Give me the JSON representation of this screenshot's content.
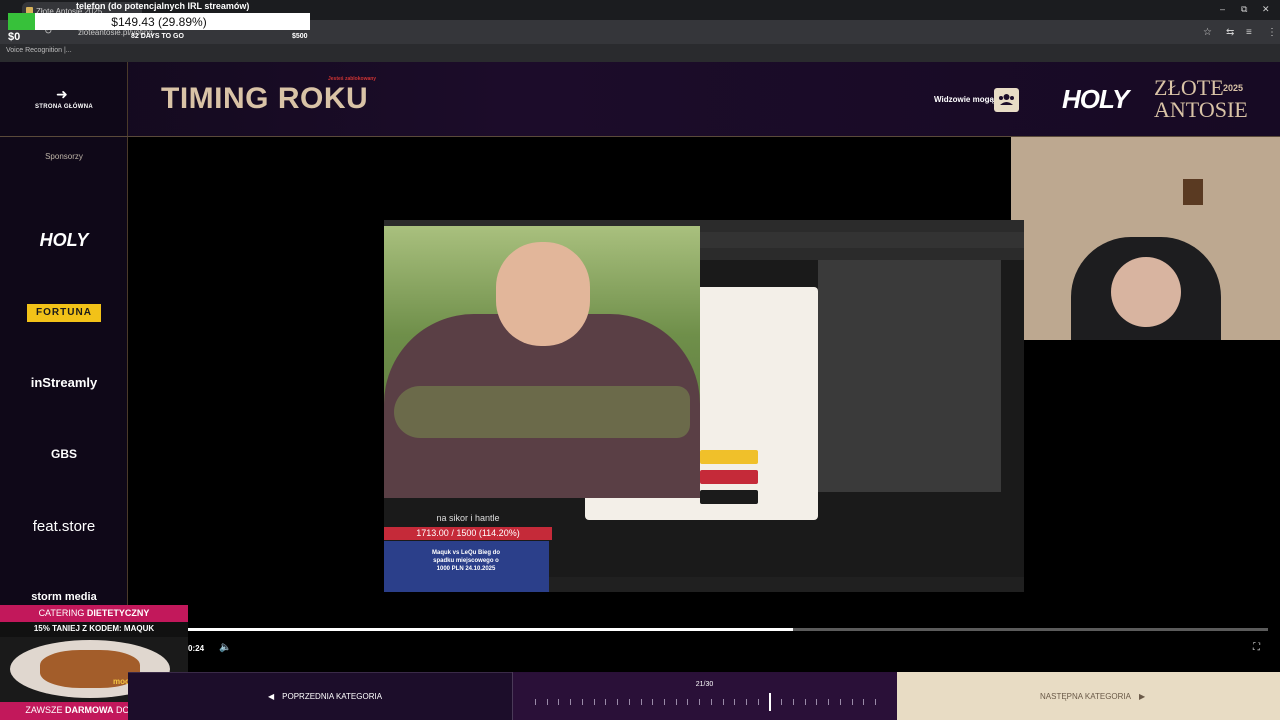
{
  "browser": {
    "tab_title": "Złote Antosie 2025",
    "url": "zloteantosie.pl/voting",
    "voice_label": "Voice Recognition |...",
    "controls": {
      "minimize": "–",
      "restore": "⧉",
      "close": "✕"
    }
  },
  "overlay": {
    "title": "telefon (do potencjalnych IRL streamów)",
    "amount": "$149.43 (29.89%)",
    "progress_pct": 29.89,
    "min": "$0",
    "days": "82 DAYS TO GO",
    "max": "$500"
  },
  "header": {
    "back_label": "STRONA GŁÓWNA",
    "title": "TIMING ROKU",
    "viewers_label": "Widzowie mogą",
    "brand_holy": "HOLY",
    "brand_zlote": "ZŁOTE",
    "brand_antosie": "ANTOSIE",
    "brand_year": "2025"
  },
  "sidebar": {
    "sponsors_label": "Sponsorzy",
    "sponsors": [
      "HOLY",
      "FORTUNA",
      "inStreamly",
      "GBS",
      "feat.store",
      "storm media"
    ]
  },
  "video": {
    "donation_label": "na sikor i hantle",
    "donation_value": "1713.00 / 1500 (114.20%)",
    "promo_text": "Maquk vs LeQu Bieg do spadku miejscowego o 1000 PLN 24.10.2025",
    "popup_title": "Jesteś zablokowany",
    "time": "0:24",
    "progress_pct": 56
  },
  "catering": {
    "top_prefix": "CATERING ",
    "top_bold": "DIETETYCZNY",
    "promo": "15% TANIEJ Z KODEM: MAQUK",
    "brand": "mood",
    "bottom_prefix": "ZAWSZE ",
    "bottom_bold": "DARMOWA",
    "bottom_suffix": " DOSTAWA!"
  },
  "footer": {
    "prev_label": "POPRZEDNIA KATEGORIA",
    "counter": "21/30",
    "next_label": "NASTĘPNA KATEGORIA"
  },
  "colors": {
    "accent_gold": "#d9c3a6",
    "progress_green": "#37c13a",
    "catering_pink": "#c2185b"
  }
}
